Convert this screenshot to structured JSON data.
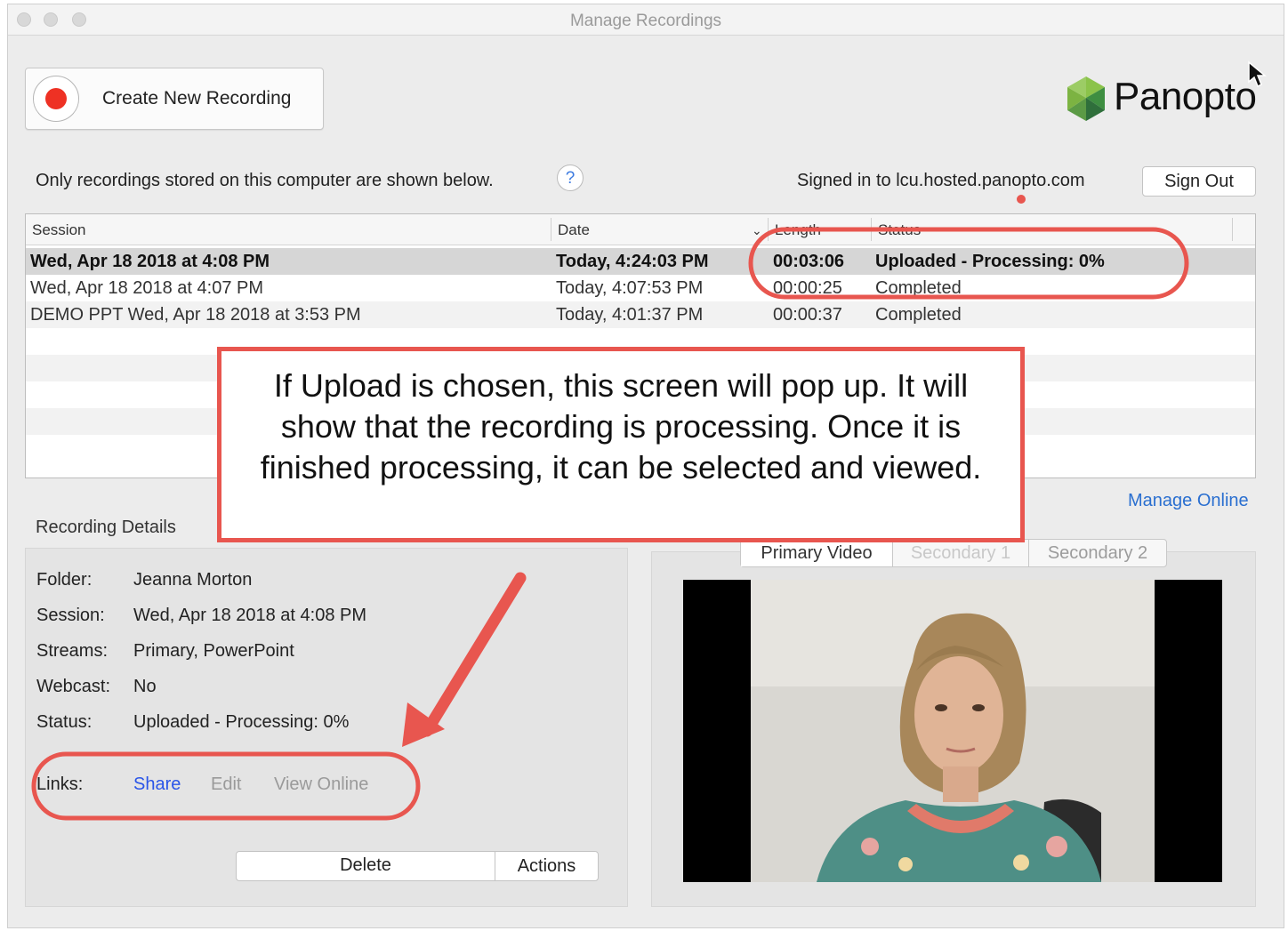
{
  "window": {
    "title": "Manage Recordings"
  },
  "toolbar": {
    "create_label": "Create New Recording"
  },
  "brand": {
    "name": "Panopto",
    "colors": [
      "#5b9a45",
      "#2f6f3b",
      "#8bc34a",
      "#3e8e41"
    ]
  },
  "info": {
    "stored_text": "Only recordings stored on this computer are shown below.",
    "help": "?",
    "signed_in_text": "Signed in to lcu.hosted.panopto.com",
    "sign_out": "Sign Out"
  },
  "table": {
    "columns": [
      "Session",
      "Date",
      "Length",
      "Status"
    ],
    "rows": [
      {
        "session": "Wed, Apr 18 2018 at 4:08 PM",
        "date": "Today, 4:24:03 PM",
        "length": "00:03:06",
        "status": "Uploaded - Processing: 0%"
      },
      {
        "session": "Wed, Apr 18 2018 at 4:07 PM",
        "date": "Today, 4:07:53 PM",
        "length": "00:00:25",
        "status": "Completed"
      },
      {
        "session": "DEMO PPT Wed, Apr 18 2018 at 3:53 PM",
        "date": "Today, 4:01:37 PM",
        "length": "00:00:37",
        "status": "Completed"
      }
    ]
  },
  "callout": {
    "text": "If Upload is chosen, this screen will pop up. It will show that the recording is processing. Once it is finished processing, it can be selected and viewed."
  },
  "details": {
    "title": "Recording Details",
    "manage_online": "Manage Online",
    "folder_label": "Folder:",
    "folder_value": "Jeanna Morton",
    "session_label": "Session:",
    "session_value": "Wed, Apr 18 2018 at 4:08 PM",
    "streams_label": "Streams:",
    "streams_value": "Primary, PowerPoint",
    "webcast_label": "Webcast:",
    "webcast_value": "No",
    "status_label": "Status:",
    "status_value": "Uploaded - Processing: 0%",
    "links_label": "Links:",
    "link_share": "Share",
    "link_edit": "Edit",
    "link_view": "View Online",
    "delete": "Delete",
    "actions": "Actions"
  },
  "preview": {
    "tabs": [
      "Primary Video",
      "Secondary 1",
      "Secondary 2"
    ]
  },
  "annotation": {
    "color": "#e8564f"
  }
}
